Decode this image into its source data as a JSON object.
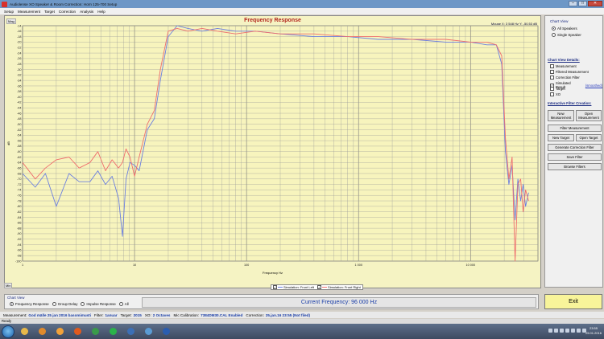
{
  "window": {
    "title": "Audiolense XO Speaker & Room Correction: Horn 125-700 Setup"
  },
  "window_controls": {
    "minimize": "–",
    "maximize": "□",
    "close": "✕"
  },
  "menu": [
    "Setup",
    "Measurement",
    "Target",
    "Correction",
    "Analysis",
    "Help"
  ],
  "plot": {
    "mode_tag": "Mag",
    "title": "Frequency Response",
    "readout": "Mouse X: 3 548 Hz   Y: -50.53 dB",
    "yunit": "dB",
    "xunit": "Frequency Hz",
    "lower_tag": "Min",
    "legend": [
      {
        "label": "Simulation: Front Left",
        "color": "#6b7fe0",
        "checked": true
      },
      {
        "label": "Simulation: Front Right",
        "color": "#ef6e6e",
        "checked": true
      }
    ]
  },
  "chart_data": {
    "type": "line",
    "xscale": "log",
    "xlim": [
      1,
      40000
    ],
    "ylim": [
      -100,
      -14
    ],
    "grid": true,
    "yticks": [
      -14,
      -16,
      -18,
      -20,
      -22,
      -24,
      -26,
      -28,
      -30,
      -32,
      -34,
      -36,
      -38,
      -40,
      -42,
      -44,
      -46,
      -48,
      -50,
      -52,
      -54,
      -56,
      -58,
      -60,
      -62,
      -64,
      -66,
      -68,
      -70,
      -72,
      -74,
      -76,
      -78,
      -80,
      -82,
      -84,
      -86,
      -88,
      -90,
      -92,
      -94,
      -96,
      -98,
      -100
    ],
    "xticks": [
      {
        "value": 1,
        "label": "1"
      },
      {
        "value": 10,
        "label": "10"
      },
      {
        "value": 100,
        "label": "100"
      },
      {
        "value": 1000,
        "label": "1 000"
      },
      {
        "value": 10000,
        "label": "10 000"
      }
    ],
    "series": [
      {
        "name": "Simulation: Front Left",
        "color": "#6b7fe0",
        "x": [
          1,
          1.3,
          1.6,
          2,
          2.6,
          3.2,
          4,
          4.7,
          5.5,
          6.3,
          7.2,
          7.8,
          8.4,
          9.1,
          10,
          11,
          13,
          15,
          17,
          20,
          24,
          30,
          40,
          55,
          80,
          120,
          200,
          400,
          800,
          1500,
          3000,
          6000,
          10000,
          14000,
          17000,
          19000,
          20500,
          22000,
          23500,
          25000,
          26500,
          28000,
          29500,
          31000,
          33000
        ],
        "y": [
          -68,
          -73,
          -68,
          -80,
          -68,
          -71,
          -71,
          -67,
          -72,
          -69,
          -77,
          -91,
          -70,
          -64,
          -65,
          -67,
          -52,
          -48,
          -34,
          -18,
          -14,
          -15,
          -16,
          -15,
          -16,
          -16,
          -17,
          -18,
          -18,
          -19,
          -19,
          -20,
          -20,
          -21,
          -21,
          -28,
          -60,
          -72,
          -65,
          -85,
          -70,
          -78,
          -72,
          -80,
          -75
        ]
      },
      {
        "name": "Simulation: Front Right",
        "color": "#ef6e6e",
        "x": [
          1,
          1.3,
          1.6,
          2,
          2.6,
          3.2,
          4,
          4.7,
          5.5,
          6.3,
          7.2,
          7.8,
          8.4,
          9.1,
          10,
          11,
          13,
          15,
          17,
          20,
          24,
          30,
          40,
          55,
          80,
          120,
          200,
          400,
          800,
          1500,
          3000,
          6000,
          10000,
          14000,
          17000,
          19000,
          20500,
          22000,
          23500,
          25000,
          26500,
          28000,
          29500,
          31000,
          33000
        ],
        "y": [
          -64,
          -70,
          -66,
          -63,
          -62,
          -66,
          -64,
          -60,
          -67,
          -63,
          -66,
          -64,
          -59,
          -62,
          -69,
          -62,
          -50,
          -45,
          -30,
          -16,
          -15,
          -16,
          -15,
          -16,
          -17,
          -16,
          -17,
          -17,
          -18,
          -18,
          -19,
          -19,
          -20,
          -20,
          -21,
          -25,
          -55,
          -70,
          -62,
          -100,
          -72,
          -70,
          -82,
          -74,
          -78
        ]
      }
    ]
  },
  "side_panel": {
    "chart_view_label": "Chart View",
    "all_speakers": "All Speakers",
    "single_speaker": "Single Speaker",
    "details_heading": "Chart View Details:",
    "details": [
      {
        "label": "Measurement",
        "checked": false
      },
      {
        "label": "Filtered Measurement",
        "checked": false
      },
      {
        "label": "Correction Filter",
        "checked": false
      },
      {
        "label": "Simulated Result",
        "checked": true
      },
      {
        "label": "Target",
        "checked": false
      },
      {
        "label": "XO",
        "checked": false
      }
    ],
    "smoothed_link": "(smoothed)",
    "filter_heading": "Interactive Filter Creation:",
    "new_measurement": "New Measurement",
    "open_measurement": "Open Measurement",
    "filter_measurement": "Filter Measurement",
    "new_target": "New Target",
    "open_target": "Open Target",
    "generate_filter": "Generate Correction Filter",
    "save_filter": "Save Filter",
    "browse_filters": "Browse Filters"
  },
  "bottom": {
    "chart_view_label": "Chart View",
    "options": [
      "Frequency Response",
      "Group Delay",
      "Impulse Response",
      "All"
    ],
    "selected": 0,
    "current_frequency": "Current Frequency: 96 000 Hz",
    "exit_label": "Exit"
  },
  "status": {
    "measurement_label": "Measurement:",
    "measurement": "God mälle 25 jan 2016 basomimusti",
    "filter_label": "Filter:",
    "filter": "1anuar",
    "target_label": "Target:",
    "target": "2015",
    "xo_label": "XO:",
    "xo": "2 Octaves",
    "mic_label": "Mic Calibration:",
    "mic": "7384DM30.CAL Enabled",
    "correction_label": "Correction:",
    "correction": "25.jan.16 23:55 (Not filed)",
    "ready": "Ready"
  },
  "taskbar": {
    "apps": [
      {
        "name": "explorer",
        "color": "#e7b84a"
      },
      {
        "name": "media",
        "color": "#e08a2c"
      },
      {
        "name": "player",
        "color": "#f2a23a"
      },
      {
        "name": "firefox",
        "color": "#e05a1e"
      },
      {
        "name": "chrome",
        "color": "#3a9a4a"
      },
      {
        "name": "spotify",
        "color": "#2bb34a"
      },
      {
        "name": "app",
        "color": "#3c6fb6"
      },
      {
        "name": "audiolense",
        "color": "#5a9bd4"
      },
      {
        "name": "word",
        "color": "#2a5db0"
      }
    ],
    "time": "23:55",
    "date": "25.01.2016"
  }
}
